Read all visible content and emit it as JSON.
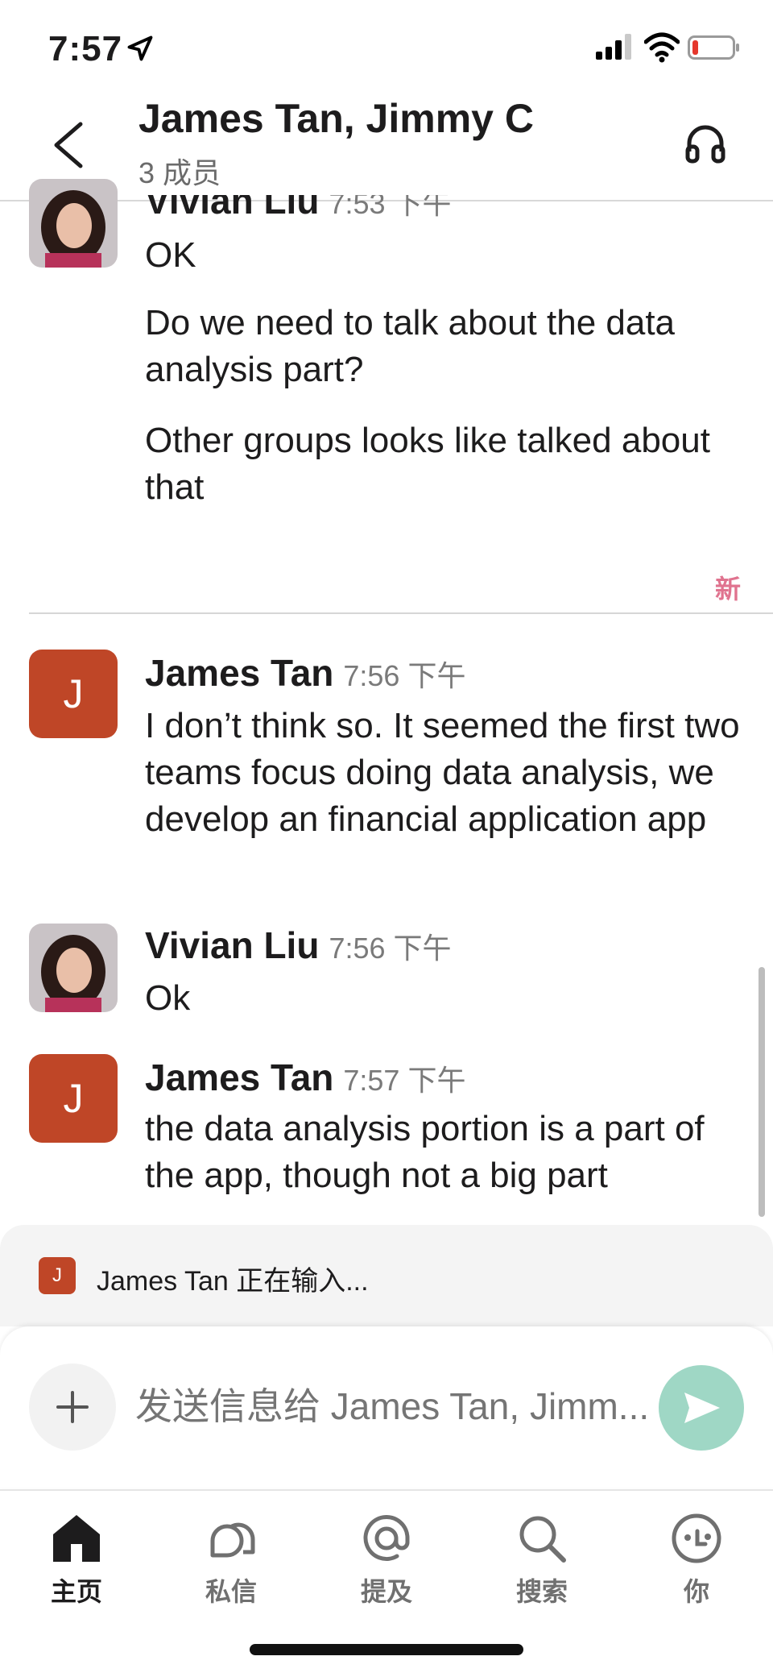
{
  "status_bar": {
    "time": "7:57"
  },
  "header": {
    "title": "James Tan, Jimmy C",
    "subtitle": "3 成员"
  },
  "messages": [
    {
      "author": "Vivian Liu",
      "time": "7:53 下午",
      "lines": [
        "OK",
        "Do we need to talk about the data analysis part?",
        "Other groups looks like talked about that"
      ]
    },
    {
      "author": "James Tan",
      "avatar_letter": "J",
      "time": "7:56 下午",
      "lines": [
        "I don’t think so. It seemed the first two teams focus doing data analysis, we develop an financial application app"
      ]
    },
    {
      "author": "Vivian Liu",
      "time": "7:56 下午",
      "lines": [
        "Ok"
      ]
    },
    {
      "author": "James Tan",
      "avatar_letter": "J",
      "time": "7:57 下午",
      "lines": [
        "the data analysis portion is a part of the app, though not a big part"
      ]
    }
  ],
  "new_divider": {
    "label": "新"
  },
  "typing": {
    "avatar_letter": "J",
    "text": "James Tan 正在输入..."
  },
  "composer": {
    "placeholder": "发送信息给 James Tan, Jimm..."
  },
  "tabs": [
    {
      "label": "主页",
      "icon": "home-icon",
      "active": true
    },
    {
      "label": "私信",
      "icon": "direct-messages-icon",
      "active": false
    },
    {
      "label": "提及",
      "icon": "at-mention-icon",
      "active": false
    },
    {
      "label": "搜索",
      "icon": "search-icon",
      "active": false
    },
    {
      "label": "你",
      "icon": "profile-icon",
      "active": false
    }
  ],
  "colors": {
    "avatar_j": "#bf4627",
    "send_button": "#9fd7c5",
    "new_label": "#e0738f"
  }
}
